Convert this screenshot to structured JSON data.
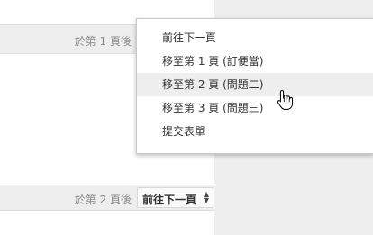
{
  "section1": {
    "after_page_label": "於第 1 頁後"
  },
  "section2": {
    "after_page_label": "於第 2 頁後",
    "selected_option": "前往下一頁"
  },
  "menu": {
    "items": [
      {
        "label": "前往下一頁"
      },
      {
        "label": "移至第 1 頁 (訂便當)"
      },
      {
        "label": "移至第 2 頁 (問題二)"
      },
      {
        "label": "移至第 3 頁 (問題三)"
      },
      {
        "label": "提交表單"
      }
    ],
    "hovered_index": 2
  },
  "icons": {
    "select_arrows": "up-down-arrows-icon",
    "cursor": "hand-pointer-icon"
  }
}
